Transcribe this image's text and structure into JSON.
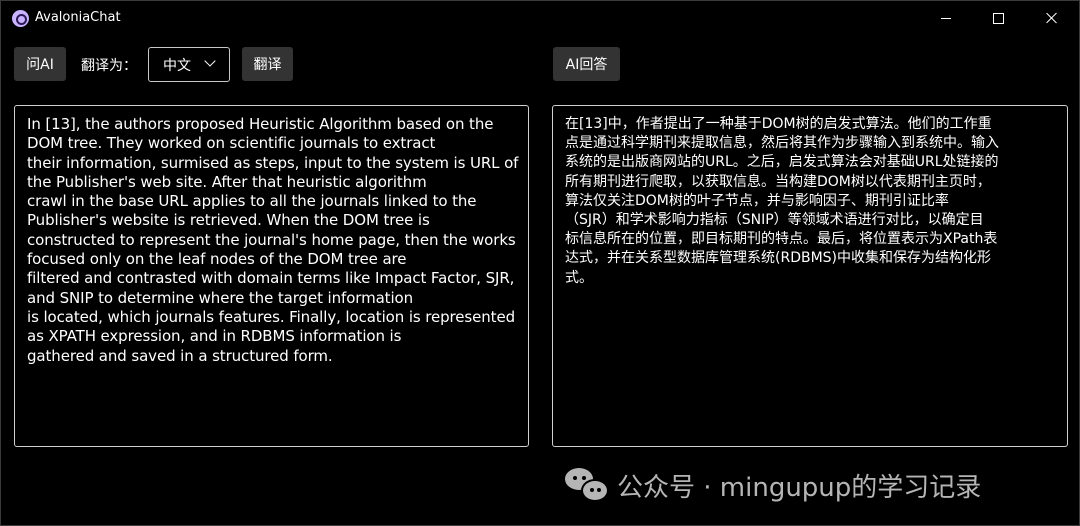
{
  "window": {
    "title": "AvaloniaChat"
  },
  "toolbar": {
    "ask_ai_label": "问AI",
    "translate_to_label": "翻译为：",
    "language_selected": "中文",
    "translate_button_label": "翻译",
    "ai_answer_label": "AI回答"
  },
  "input_pane": {
    "text": "In [13], the authors proposed Heuristic Algorithm based on the\nDOM tree. They worked on scientific journals to extract\ntheir information, surmised as steps, input to the system is URL of\nthe Publisher's web site. After that heuristic algorithm\ncrawl in the base URL applies to all the journals linked to the\nPublisher's website is retrieved. When the DOM tree is\nconstructed to represent the journal's home page, then the works\nfocused only on the leaf nodes of the DOM tree are\nfiltered and contrasted with domain terms like Impact Factor, SJR,\nand SNIP to determine where the target information\nis located, which journals features. Finally, location is represented\nas XPATH expression, and in RDBMS information is\ngathered and saved in a structured form."
  },
  "output_pane": {
    "text": "在[13]中，作者提出了一种基于DOM树的启发式算法。他们的工作重\n点是通过科学期刊来提取信息，然后将其作为步骤输入到系统中。输入\n系统的是出版商网站的URL。之后，启发式算法会对基础URL处链接的\n所有期刊进行爬取，以获取信息。当构建DOM树以代表期刊主页时，\n算法仅关注DOM树的叶子节点，并与影响因子、期刊引证比率\n（SJR）和学术影响力指标（SNIP）等领域术语进行对比，以确定目\n标信息所在的位置，即目标期刊的特点。最后，将位置表示为XPath表\n达式，并在关系型数据库管理系统(RDBMS)中收集和保存为结构化形\n式。"
  },
  "watermark": {
    "text": "公众号 · mingupup的学习记录"
  },
  "colors": {
    "background": "#000000",
    "button": "#333333",
    "border": "#cfcfcf",
    "app_icon": "#c9b3ff",
    "watermark": "#b5b5b5"
  }
}
